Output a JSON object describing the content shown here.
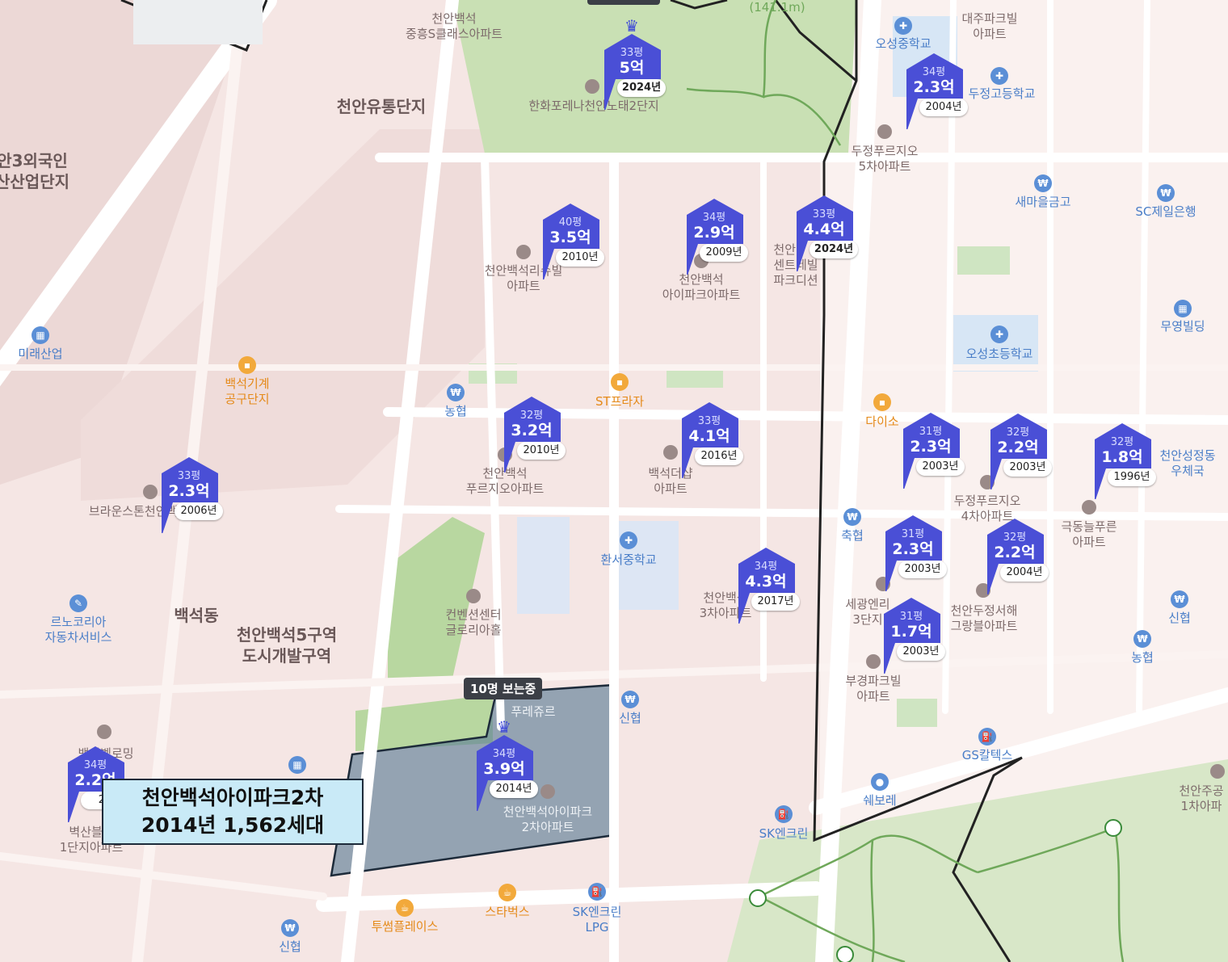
{
  "map": {
    "top_left_labels": [],
    "area_labels": {
      "industrial_complex": "천안유통단지",
      "foreign_industry": "안3외국인\n산산업단지",
      "baekseok_dong": "백석동",
      "redevelopment": "천안백석5구역\n도시개발구역",
      "distance": "(141.1m)"
    },
    "places": [
      {
        "text": "천안백석\n중흥S클래스아파트",
        "style": "gray"
      },
      {
        "text": "한화포레나천안노태2단지",
        "style": "gray"
      },
      {
        "text": "대주파크빌\n아파트",
        "style": "gray"
      },
      {
        "text": "오성중학교",
        "style": "blue"
      },
      {
        "text": "두정고등학교",
        "style": "blue"
      },
      {
        "text": "두정푸르지오\n5차아파트",
        "style": "gray"
      },
      {
        "text": "새마을금고",
        "style": "blue"
      },
      {
        "text": "SC제일은행",
        "style": "blue"
      },
      {
        "text": "천안백석리슈빌\n아파트",
        "style": "gray"
      },
      {
        "text": "천안백석\n아이파크아파트",
        "style": "gray"
      },
      {
        "text": "천안\n센트레빌\n파크디션",
        "style": "gray"
      },
      {
        "text": "무영빌딩",
        "style": "blue"
      },
      {
        "text": "오성초등학교",
        "style": "blue"
      },
      {
        "text": "미래산업",
        "style": "blue"
      },
      {
        "text": "백석기계\n공구단지",
        "style": "orange"
      },
      {
        "text": "농협",
        "style": "blue"
      },
      {
        "text": "ST프라자",
        "style": "orange"
      },
      {
        "text": "다이소",
        "style": "orange"
      },
      {
        "text": "천안성정동\n우체국",
        "style": "blue"
      },
      {
        "text": "천안백석\n푸르지오아파트",
        "style": "gray"
      },
      {
        "text": "백석더샵\n아파트",
        "style": "gray"
      },
      {
        "text": "브라운스톤천안백석",
        "style": "gray"
      },
      {
        "text": "두정푸르지오\n4차아파트",
        "style": "gray"
      },
      {
        "text": "극동늘푸른\n아파트",
        "style": "gray"
      },
      {
        "text": "축협",
        "style": "blue"
      },
      {
        "text": "환서중학교",
        "style": "blue"
      },
      {
        "text": "천안백석\n3차아파트",
        "style": "gray"
      },
      {
        "text": "세광엔리\n3단지",
        "style": "gray"
      },
      {
        "text": "천안두정서해\n그랑블아파트",
        "style": "gray"
      },
      {
        "text": "신협",
        "style": "blue"
      },
      {
        "text": "르노코리아\n자동차서비스",
        "style": "blue"
      },
      {
        "text": "컨벤션센터\n글로리아홀",
        "style": "gray"
      },
      {
        "text": "부경파크빌\n아파트",
        "style": "gray"
      },
      {
        "text": "농협",
        "style": "blue"
      },
      {
        "text": "신협",
        "style": "blue"
      },
      {
        "text": "GS칼텍스",
        "style": "blue"
      },
      {
        "text": "천안주공\n1차아파",
        "style": "gray"
      },
      {
        "text": "쉐보레",
        "style": "blue"
      },
      {
        "text": "SK엔크린",
        "style": "blue"
      },
      {
        "text": "천안백석아이파크\n2차아파트",
        "style": "gray"
      },
      {
        "text": "백석벨로밍\n스타",
        "style": "gray"
      },
      {
        "text": "벽산블루\n1단지아파트",
        "style": "gray"
      },
      {
        "text": "투썸플레이스",
        "style": "orange"
      },
      {
        "text": "스타벅스",
        "style": "orange"
      },
      {
        "text": "SK엔크린\nLPG",
        "style": "blue"
      },
      {
        "text": "신협",
        "style": "blue"
      },
      {
        "text": "푸레쥬르",
        "style": "gray"
      }
    ],
    "markers": [
      {
        "pyeong": "33평",
        "price": "5억",
        "year": "2024년",
        "new": true,
        "crown": true
      },
      {
        "pyeong": "34평",
        "price": "2.3억",
        "year": "2004년",
        "new": false
      },
      {
        "pyeong": "40평",
        "price": "3.5억",
        "year": "2010년",
        "new": false
      },
      {
        "pyeong": "34평",
        "price": "2.9억",
        "year": "2009년",
        "new": false
      },
      {
        "pyeong": "33평",
        "price": "4.4억",
        "year": "2024년",
        "new": true
      },
      {
        "pyeong": "32평",
        "price": "3.2억",
        "year": "2010년",
        "new": false
      },
      {
        "pyeong": "33평",
        "price": "4.1억",
        "year": "2016년",
        "new": false
      },
      {
        "pyeong": "31평",
        "price": "2.3억",
        "year": "2003년",
        "new": false
      },
      {
        "pyeong": "32평",
        "price": "2.2억",
        "year": "2003년",
        "new": false
      },
      {
        "pyeong": "32평",
        "price": "1.8억",
        "year": "1996년",
        "new": false
      },
      {
        "pyeong": "33평",
        "price": "2.3억",
        "year": "2006년",
        "new": false
      },
      {
        "pyeong": "34평",
        "price": "4.3억",
        "year": "2017년",
        "new": false
      },
      {
        "pyeong": "31평",
        "price": "2.3억",
        "year": "2003년",
        "new": false
      },
      {
        "pyeong": "32평",
        "price": "2.2억",
        "year": "2004년",
        "new": false
      },
      {
        "pyeong": "31평",
        "price": "1.7억",
        "year": "2003년",
        "new": false
      },
      {
        "pyeong": "34평",
        "price": "3.9억",
        "year": "2014년",
        "new": false,
        "crown": true
      },
      {
        "pyeong": "34평",
        "price": "2.2억",
        "year": "20",
        "new": false
      }
    ],
    "viewing_tag": "10명 보는중",
    "callout": {
      "name": "천안백석아이파크2차",
      "detail": "2014년 1,562세대"
    },
    "colors": {
      "marker": "#4a4fd6",
      "land": "#f6e9e7",
      "park": "#c6dfb2",
      "road": "#ffffff",
      "highlight": "#5f7f96"
    }
  }
}
